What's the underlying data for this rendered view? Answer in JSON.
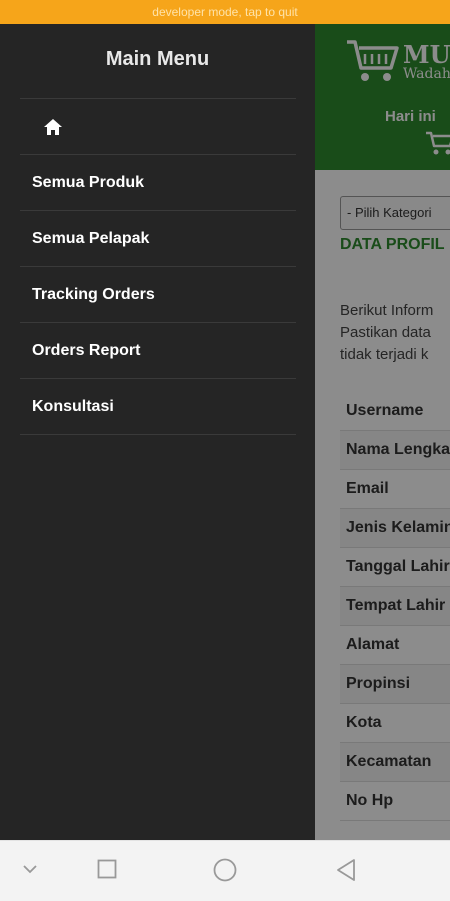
{
  "system": {
    "dev_banner": "developer mode, tap to quit"
  },
  "drawer": {
    "title": "Main Menu",
    "items": [
      {
        "label": "Semua Produk"
      },
      {
        "label": "Semua Pelapak"
      },
      {
        "label": "Tracking Orders"
      },
      {
        "label": "Orders Report"
      },
      {
        "label": "Konsultasi"
      }
    ]
  },
  "page": {
    "brand": "MUR",
    "tagline": "Wadah",
    "hari_ini": "Hari ini",
    "category_placeholder": "- Pilih Kategori",
    "section_title": "DATA PROFIL",
    "info_lines": [
      "Berikut Inform",
      "Pastikan data",
      "tidak terjadi k"
    ],
    "profile_fields": [
      "Username",
      "Nama Lengkap",
      "Email",
      "Jenis Kelamin",
      "Tanggal Lahir",
      "Tempat Lahir",
      "Alamat",
      "Propinsi",
      "Kota",
      "Kecamatan",
      "No Hp"
    ]
  },
  "colors": {
    "drawer_bg": "#252525",
    "header_green": "#2e8b2e",
    "dev_bar": "#f6a51a"
  },
  "icons": {
    "home": "home-icon",
    "cart": "cart-icon",
    "nav": [
      "chevron-down-icon",
      "square-icon",
      "circle-icon",
      "triangle-back-icon"
    ]
  }
}
